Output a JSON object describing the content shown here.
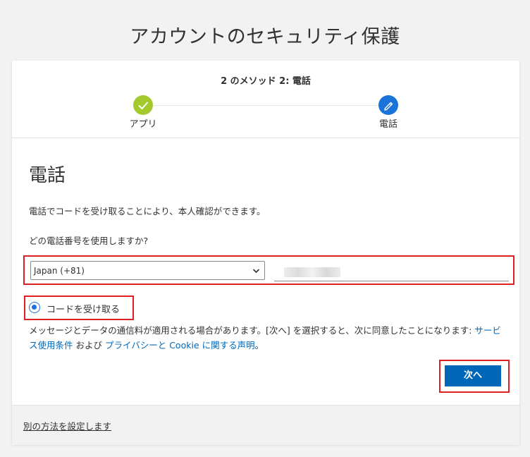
{
  "page": {
    "title": "アカウントのセキュリティ保護"
  },
  "progress": {
    "caption": "2 のメソッド 2: 電話",
    "steps": [
      {
        "label": "アプリ",
        "state": "complete",
        "icon": "checkmark-icon"
      },
      {
        "label": "電話",
        "state": "active",
        "icon": "pencil-icon"
      }
    ]
  },
  "section": {
    "title": "電話",
    "description": "電話でコードを受け取ることにより、本人確認ができます。",
    "question": "どの電話番号を使用しますか?"
  },
  "phone": {
    "country_value": "Japan (+81)",
    "number_value": ""
  },
  "radio": {
    "label": "コードを受け取る",
    "checked": true
  },
  "terms": {
    "text_1": "メッセージとデータの通信料が適用される場合があります。[次へ] を選択すると、次に同意したことになります: ",
    "link_terms": "サービス使用条件",
    "text_2": " および ",
    "link_privacy": "プライバシーと Cookie に関する声明",
    "text_3": "。"
  },
  "buttons": {
    "next": "次へ"
  },
  "footer": {
    "alt_method_link": "別の方法を設定します"
  },
  "colors": {
    "accent": "#0067b8",
    "step_complete": "#a4c92c",
    "step_active": "#1a73d9",
    "highlight": "#e02020"
  }
}
